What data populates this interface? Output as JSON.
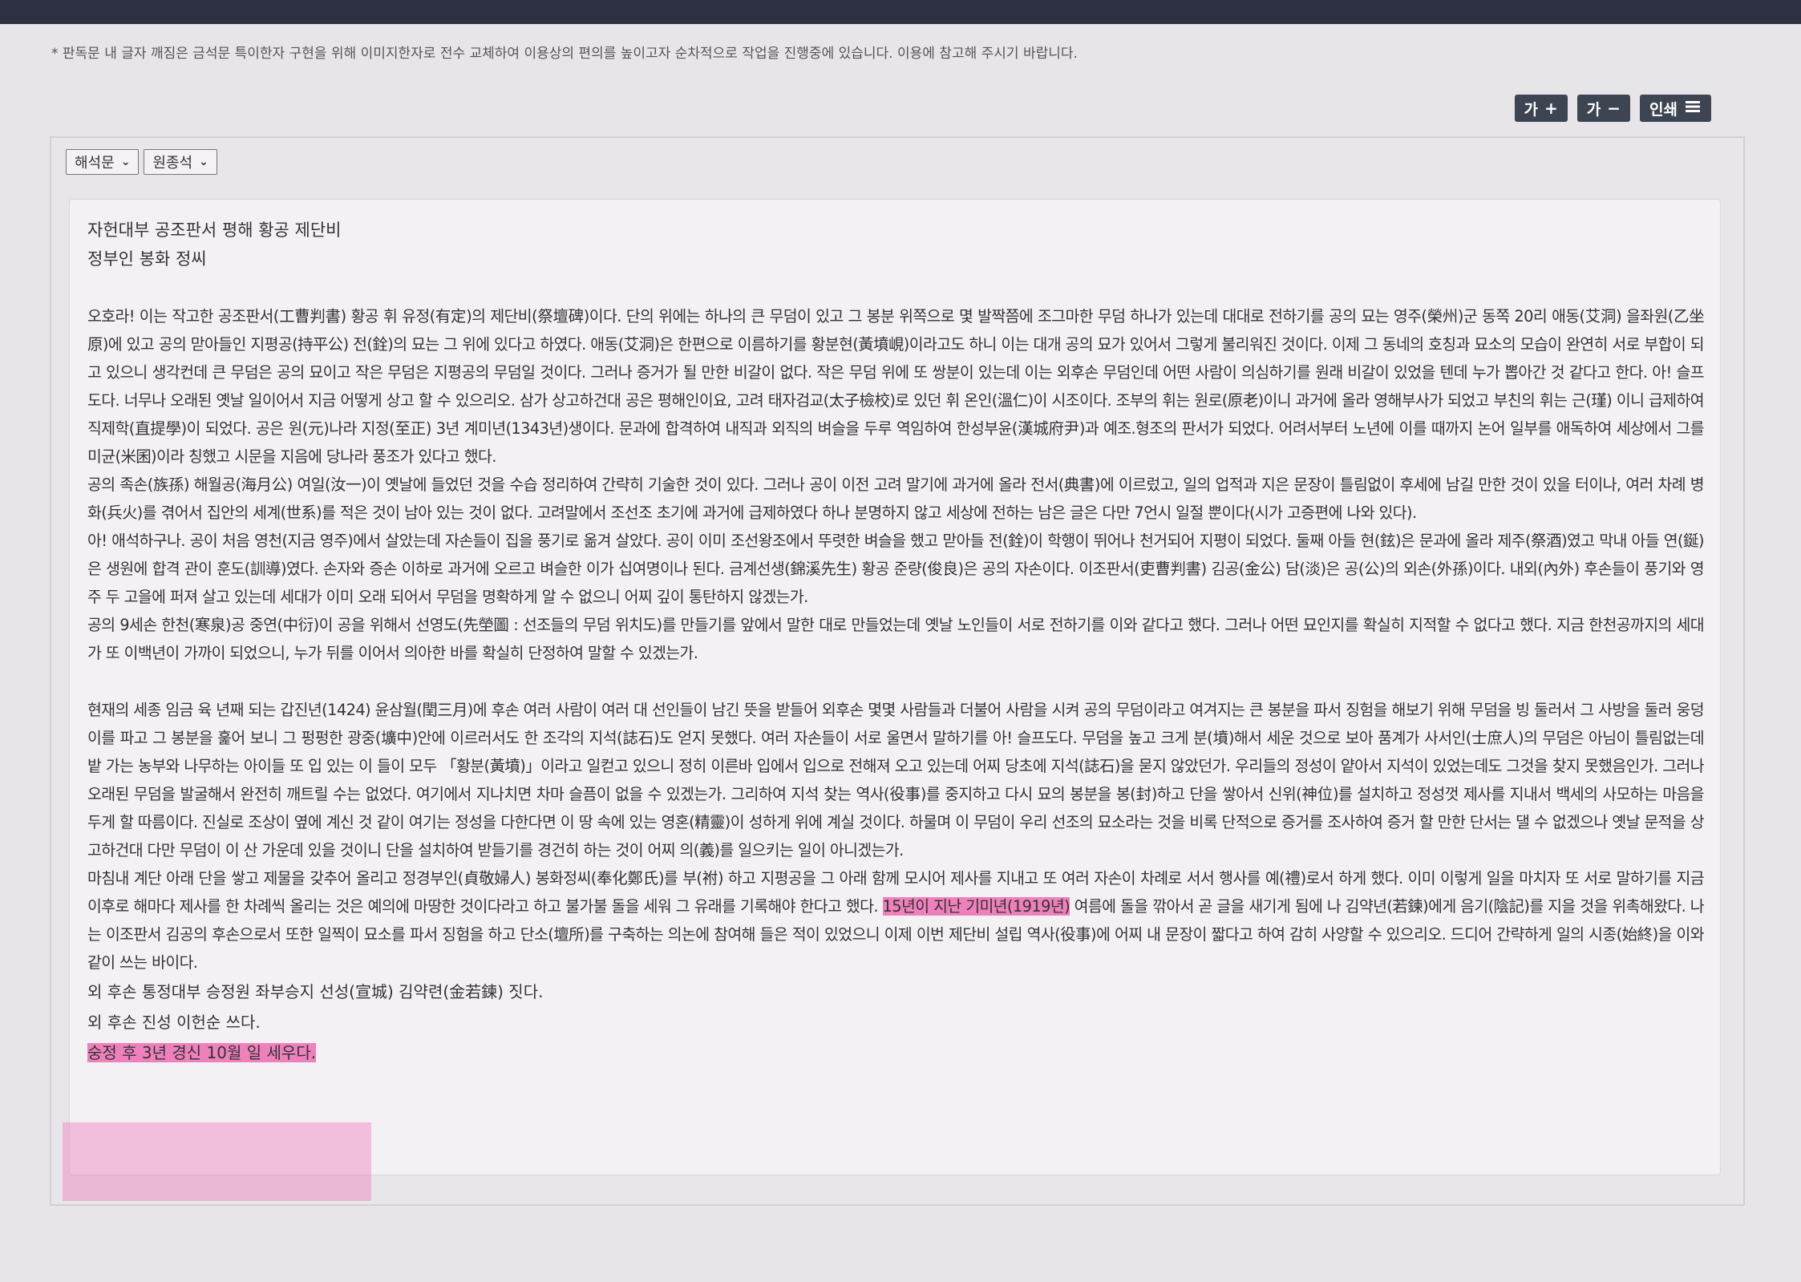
{
  "notice": "* 판독문 내 글자 깨짐은 금석문 특이한자 구현을 위해 이미지한자로 전수 교체하여 이용상의 편의를 높이고자 순차적으로 작업을 진행중에 있습니다. 이용에 참고해 주시기 바랍니다.",
  "toolbar": {
    "font_up_label": "가",
    "font_up_icon": "+",
    "font_down_label": "가",
    "font_down_icon": "−",
    "print_label": "인쇄",
    "print_icon": "print-icon"
  },
  "selects": {
    "translation": "해석문",
    "original": "원종석"
  },
  "document": {
    "title1": "자헌대부 공조판서 평해 황공 제단비",
    "title2": "정부인 봉화 정씨",
    "p1": "오호라! 이는 작고한 공조판서(工曹判書) 황공 휘 유정(有定)의 제단비(祭壇碑)이다. 단의 위에는 하나의 큰 무덤이 있고 그 봉분 위쪽으로 몇 발짝쯤에 조그마한 무덤 하나가 있는데 대대로 전하기를 공의 묘는 영주(榮州)군 동쪽 20리 애동(艾洞) 을좌원(乙坐原)에 있고 공의 맏아들인 지평공(持平公) 전(銓)의 묘는 그 위에 있다고 하였다. 애동(艾洞)은 한편으로 이름하기를 황분현(黃墳峴)이라고도 하니 이는 대개 공의 묘가 있어서 그렇게 불리워진 것이다. 이제 그 동네의 호칭과 묘소의 모습이 완연히 서로 부합이 되고 있으니 생각컨데 큰 무덤은 공의 묘이고 작은 무덤은 지평공의 무덤일 것이다. 그러나 증거가 될 만한 비갈이 없다. 작은 무덤 위에 또 쌍분이 있는데 이는 외후손 무덤인데 어떤 사람이 의심하기를 원래 비갈이 있었을 텐데 누가 뽑아간 것 같다고 한다. 아! 슬프도다. 너무나 오래된 옛날 일이어서 지금 어떻게 상고 할 수 있으리오. 삼가 상고하건대 공은 평해인이요, 고려 태자검교(太子檢校)로 있던 휘 온인(溫仁)이 시조이다. 조부의 휘는 원로(原老)이니 과거에 올라 영해부사가 되었고 부친의 휘는 근(瑾) 이니 급제하여 직제학(直提學)이 되었다. 공은 원(元)나라 지정(至正) 3년 계미년(1343년)생이다. 문과에 합격하여 내직과 외직의 벼슬을 두루 역임하여 한성부윤(漢城府尹)과 예조.형조의 판서가 되었다. 어려서부터 노년에 이를 때까지 논어 일부를 애독하여 세상에서 그를 미균(米囷)이라 칭했고 시문을 지음에 당나라 풍조가 있다고 했다.",
    "p2": "공의 족손(族孫) 해월공(海月公) 여일(汝一)이 옛날에 들었던 것을 수습 정리하여 간략히 기술한 것이 있다. 그러나 공이 이전 고려 말기에 과거에 올라 전서(典書)에 이르렀고, 일의 업적과 지은 문장이 틀림없이 후세에 남길 만한 것이 있을 터이나, 여러 차례 병화(兵火)를 겪어서 집안의 세계(世系)를 적은 것이 남아 있는 것이 없다. 고려말에서 조선조 초기에 과거에 급제하였다 하나 분명하지 않고 세상에 전하는 남은 글은 다만 7언시 일절 뿐이다(시가 고증편에 나와 있다).",
    "p3": "아! 애석하구나. 공이 처음 영천(지금 영주)에서 살았는데 자손들이 집을 풍기로 옮겨 살았다. 공이 이미 조선왕조에서 뚜렷한 벼슬을 했고 맏아들 전(銓)이 학행이 뛰어나 천거되어 지평이 되었다. 둘째 아들 현(鉉)은 문과에 올라 제주(祭酒)였고 막내 아들 연(鋋)은 생원에 합격 관이 훈도(訓導)였다. 손자와 증손 이하로 과거에 오르고 벼슬한 이가 십여명이나 된다. 금계선생(錦溪先生) 황공 준량(俊良)은 공의 자손이다. 이조판서(吏曹判書) 김공(金公) 담(淡)은 공(公)의 외손(外孫)이다. 내외(內外) 후손들이 풍기와 영주 두 고을에 퍼져 살고 있는데 세대가 이미 오래 되어서 무덤을 명확하게 알 수 없으니 어찌 깊이 통탄하지 않겠는가.",
    "p4": "공의 9세손 한천(寒泉)공 중연(中衍)이 공을 위해서 선영도(先塋圖 : 선조들의 무덤 위치도)를 만들기를 앞에서 말한 대로 만들었는데 옛날 노인들이 서로 전하기를 이와 같다고 했다. 그러나 어떤 묘인지를 확실히 지적할 수 없다고 했다. 지금 한천공까지의 세대가 또 이백년이 가까이 되었으니, 누가 뒤를 이어서 의아한 바를 확실히 단정하여 말할 수 있겠는가.",
    "p5": "현재의 세종 임금 육 년째 되는 갑진년(1424) 윤삼월(閏三月)에 후손 여러 사람이 여러 대 선인들이 남긴 뜻을 받들어 외후손 몇몇 사람들과 더불어 사람을 시켜 공의 무덤이라고 여겨지는 큰 봉분을 파서 징험을 해보기 위해 무덤을 빙 둘러서 그 사방을 둘러 웅덩이를 파고 그 봉분을 훑어 보니 그 펑펑한 광중(壙中)안에 이르러서도 한 조각의 지석(誌石)도 얻지 못했다. 여러 자손들이 서로 울면서 말하기를 아! 슬프도다. 무덤을 높고 크게 분(墳)해서 세운 것으로 보아 품계가 사서인(士庶人)의 무덤은 아님이 틀림없는데 밭 가는 농부와 나무하는 아이들 또 입 있는 이 들이 모두 「황분(黃墳)」이라고 일컫고 있으니 정히 이른바 입에서 입으로 전해져 오고 있는데 어찌 당초에 지석(誌石)을 묻지 않았던가. 우리들의 정성이 얕아서 지석이 있었는데도 그것을 찾지 못했음인가. 그러나 오래된 무덤을 발굴해서 완전히 깨트릴 수는 없었다. 여기에서 지나치면 차마 슬픔이 없을 수 있겠는가. 그리하여 지석 찾는 역사(役事)를 중지하고 다시 묘의 봉분을 봉(封)하고 단을 쌓아서 신위(神位)를 설치하고 정성껏 제사를 지내서 백세의 사모하는 마음을 두게 할 따름이다. 진실로 조상이 옆에 계신 것 같이 여기는 정성을 다한다면 이 땅 속에 있는 영혼(精靈)이 성하게 위에 계실 것이다. 하물며 이 무덤이 우리 선조의 묘소라는 것을 비록 단적으로 증거를 조사하여 증거 할 만한 단서는 댈 수 없겠으나 옛날 문적을 상고하건대 다만 무덤이 이 산 가운데 있을 것이니 단을 설치하여 받들기를 경건히 하는 것이 어찌 의(義)를 일으키는 일이 아니겠는가.",
    "p6_a": "마침내 계단 아래 단을 쌓고 제물을 갖추어 올리고 정경부인(貞敬婦人) 봉화정씨(奉化鄭氏)를 부(祔) 하고 지평공을 그 아래 함께 모시어 제사를 지내고 또 여러 자손이 차례로 서서 행사를 예(禮)로서 하게 했다. 이미 이렇게 일을 마치자 또 서로 말하기를 지금 이후로 해마다 제사를 한 차례씩 올리는 것은 예의에 마땅한 것이다라고 하고 불가불 돌을 세워 그 유래를 기록해야 한다고 했다. ",
    "p6_hl": "15년이 지난 기미년(1919년)",
    "p6_b": " 여름에 돌을 깎아서 곧 글을 새기게 됨에 나 김약년(若鍊)에게 음기(陰記)를 지을 것을 위촉해왔다. 나는 이조판서 김공의 후손으로서 또한 일찍이 묘소를 파서 징험을 하고 단소(壇所)를 구축하는 의논에 참여해 들은 적이 있었으니 이제 이번 제단비 설립 역사(役事)에 어찌 내 문장이 짧다고 하여 감히 사양할 수 있으리오. 드디어 간략하게 일의 시종(始終)을 이와같이 쓰는 바이다.",
    "sign1": "외 후손 통정대부 승정원 좌부승지 선성(宣城) 김약련(金若鍊) 짓다.",
    "sign2": "외 후손 진성 이헌순 쓰다.",
    "sign3": "숭정 후 3년 경신 10월 일 세우다."
  },
  "colors": {
    "toolbar_button": "#3d4452",
    "highlight": "#ec5aaa",
    "top_bar": "#2c3040"
  }
}
